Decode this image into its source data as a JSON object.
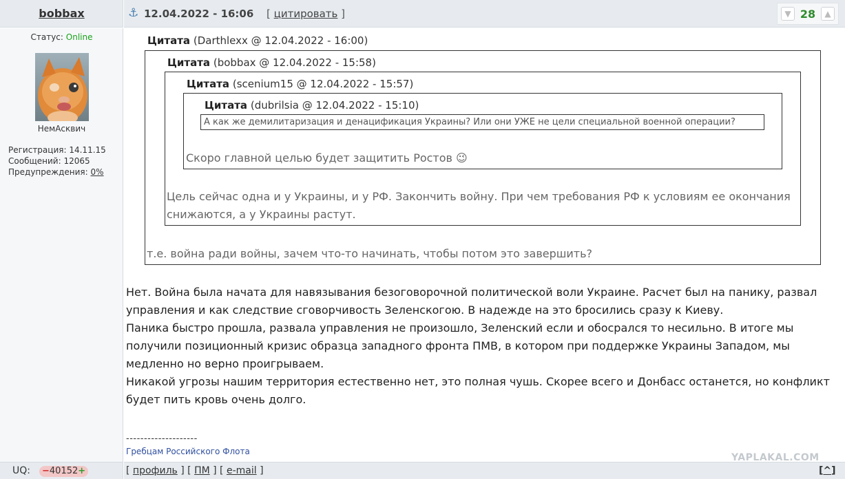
{
  "post": {
    "username": "bobbax",
    "date": "12.04.2022 - 16:06",
    "quote_link": "цитировать",
    "rating": "28"
  },
  "sidebar": {
    "status_label": "Статус:",
    "status_value": "Online",
    "nick_caption": "НемАсквич",
    "reg_label": "Регистрация:",
    "reg_value": "14.11.15",
    "msgs_label": "Сообщений:",
    "msgs_value": "12065",
    "warn_label": "Предупреждения:",
    "warn_value": "0%"
  },
  "quotes": {
    "q1": {
      "label": "Цитата",
      "meta": "(Darthlexx @ 12.04.2022 - 16:00)",
      "text": "т.е. война ради войны, зачем что-то начинать, чтобы потом это завершить?"
    },
    "q2": {
      "label": "Цитата",
      "meta": "(bobbax @ 12.04.2022 - 15:58)",
      "text": "Цель сейчас одна и у Украины, и у РФ. Закончить войну. При чем требования РФ к условиям ее окончания снижаются, а у Украины растут."
    },
    "q3": {
      "label": "Цитата",
      "meta": "(scenium15 @ 12.04.2022 - 15:57)",
      "text": "Скоро главной целью будет защитить Ростов 😉"
    },
    "q4": {
      "label": "Цитата",
      "meta": "(dubrilsia @ 12.04.2022 - 15:10)",
      "text": "А как же демилитаризация и денацификация Украины? Или они УЖЕ не цели специальной военной операции?"
    }
  },
  "body": {
    "p1": "Нет. Война была начата для навязывания безоговорочной политической воли Украине. Расчет был на панику, развал управления и как следствие сговорчивость Зеленскогою. В надежде на это бросились сразу к Киеву.",
    "p2": "Паника быстро прошла, развала управления не произошло, Зеленский если и обосрался то несильно. В итоге мы получили позиционный кризис образца западного фронта ПМВ, в котором при поддержке Украины Западом, мы медленно но верно проигрываем.",
    "p3": "Никакой угрозы нашим территория естественно нет, это полная чушь. Скорее всего и Донбасс останется, но конфликт будет пить кровь очень долго."
  },
  "signature": {
    "separator": "--------------------",
    "text": "Гребцам Российского Флота"
  },
  "watermark": "YAPLAKAL.COM",
  "footer": {
    "uq_label": "UQ:",
    "uq_minus": "−",
    "uq_value": "40152",
    "uq_plus": "+",
    "profile": "профиль",
    "pm": "ПМ",
    "email": "e-mail",
    "top": "^"
  },
  "colors": {
    "header_bg": "#e7ebef",
    "online": "#1aa31a",
    "rating": "#2e8b2e",
    "signature": "#2f4fa0"
  }
}
